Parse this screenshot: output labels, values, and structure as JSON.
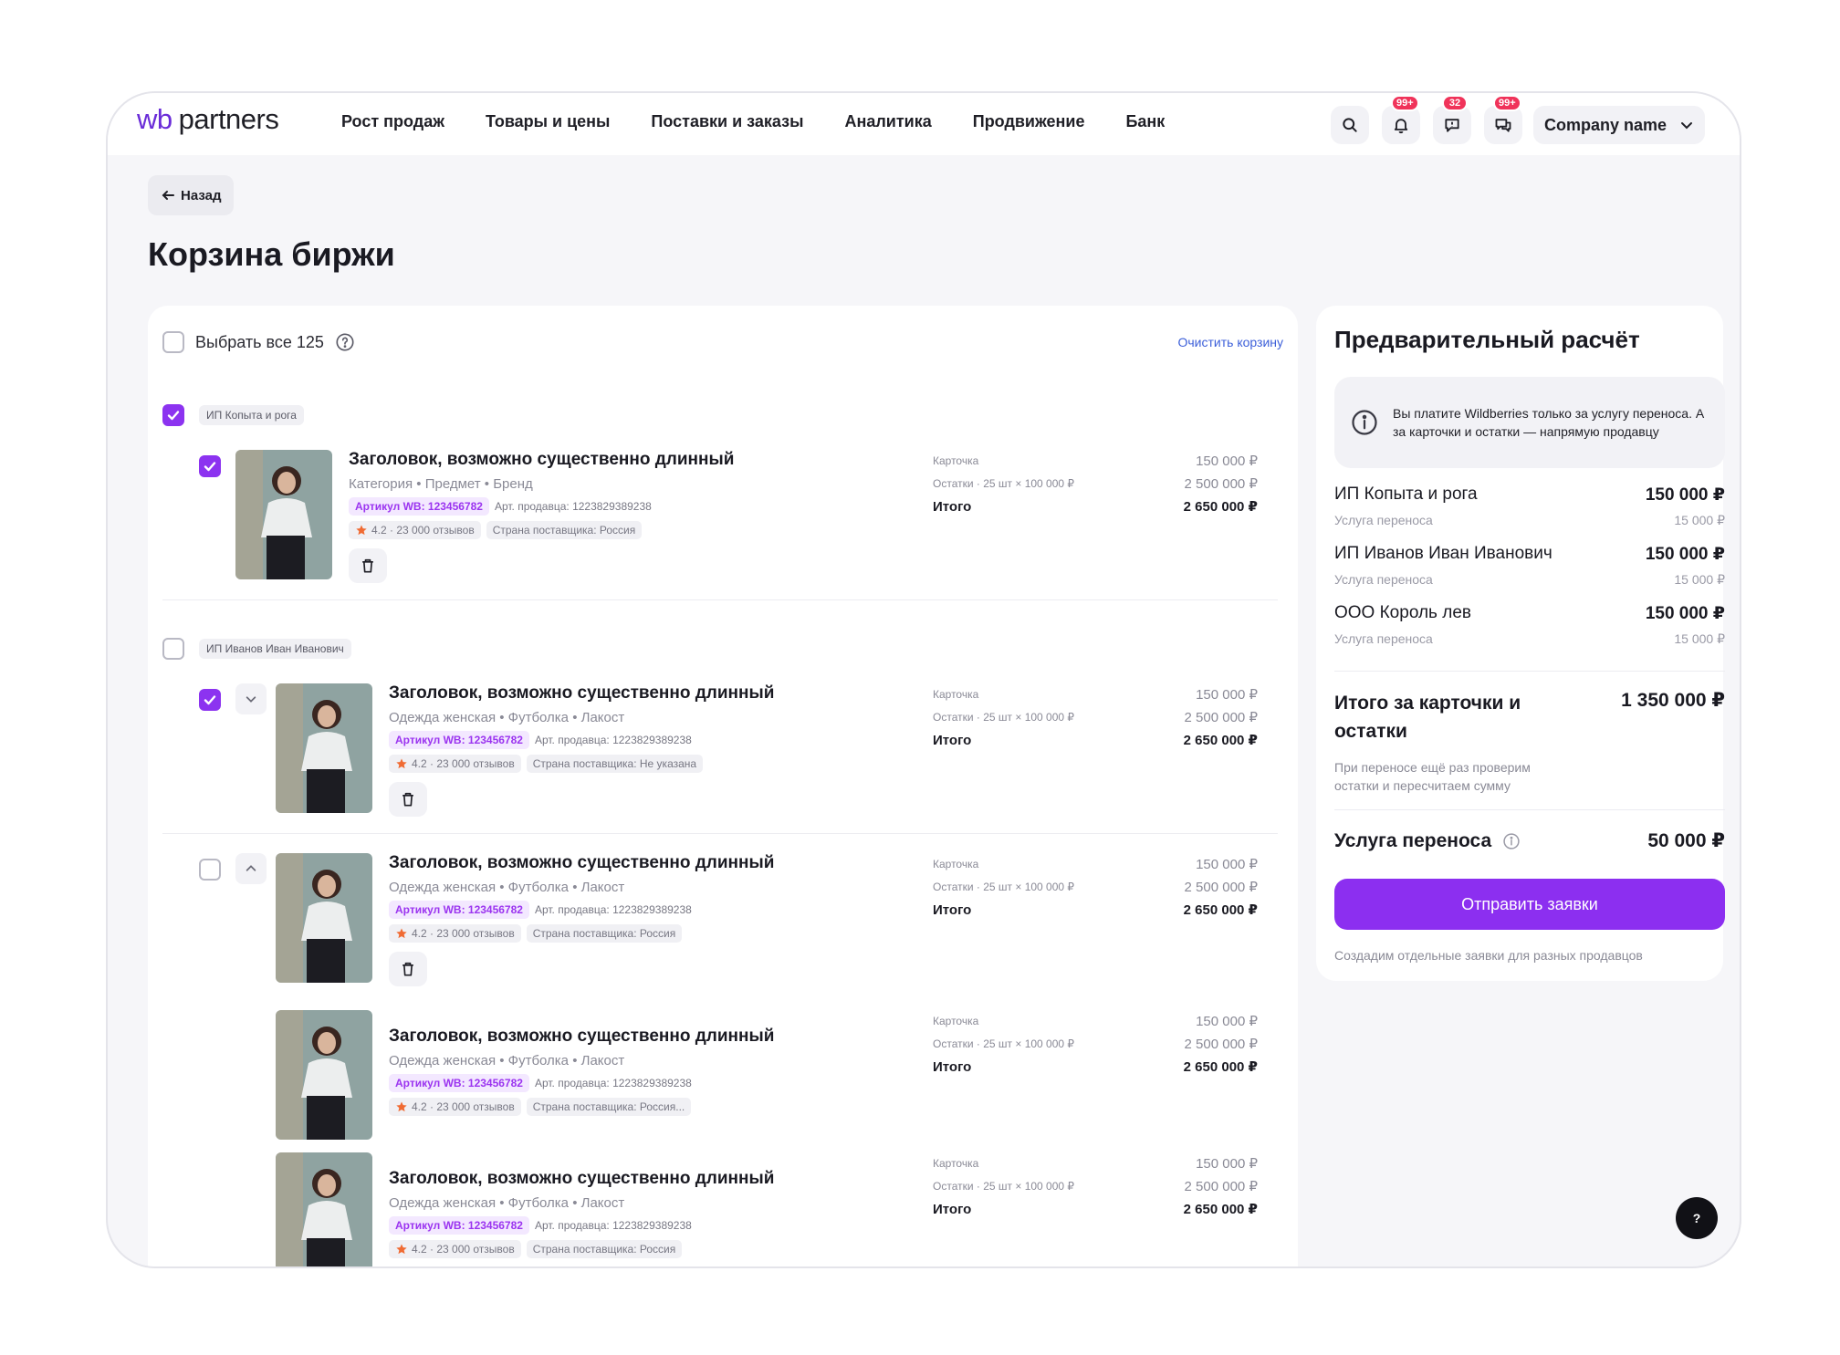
{
  "header": {
    "logo_wb": "wb",
    "logo_text": "partners",
    "nav": [
      "Рост продаж",
      "Товары и цены",
      "Поставки и заказы",
      "Аналитика",
      "Продвижение",
      "Банк"
    ],
    "badges": {
      "notifications": "99+",
      "feedback": "32",
      "chat": "99+"
    },
    "company": "Company name"
  },
  "page": {
    "back_label": "Назад",
    "title": "Корзина биржи"
  },
  "cart": {
    "select_all_label": "Выбрать все 125",
    "clear_label": "Очистить корзину",
    "row_labels": {
      "card": "Карточка",
      "stock": "Остатки · 25 шт × 100 000 ₽",
      "total": "Итого"
    },
    "row_values": {
      "card": "150 000 ₽",
      "stock": "2 500 000 ₽",
      "total": "2 650 000 ₽"
    },
    "sellers": [
      {
        "name": "ИП Копыта и рога"
      },
      {
        "name": "ИП Иванов Иван Иванович"
      }
    ],
    "items": [
      {
        "title": "Заголовок, возможно существенно длинный",
        "subtitle": "Категория • Предмет • Бренд",
        "article": "Артикул WB: 123456782",
        "seller_art": "Арт. продавца: 1223829389238",
        "rating": "4.2 · 23 000 отзывов",
        "country": "Страна поставщика: Россия"
      },
      {
        "title": "Заголовок, возможно существенно длинный",
        "subtitle": "Одежда женская • Футболка • Лакост",
        "article": "Артикул WB: 123456782",
        "seller_art": "Арт. продавца: 1223829389238",
        "rating": "4.2 · 23 000 отзывов",
        "country": "Страна поставщика: Не указана"
      },
      {
        "title": "Заголовок, возможно существенно длинный",
        "subtitle": "Одежда женская • Футболка • Лакост",
        "article": "Артикул WB: 123456782",
        "seller_art": "Арт. продавца: 1223829389238",
        "rating": "4.2 · 23 000 отзывов",
        "country": "Страна поставщика: Россия"
      },
      {
        "title": "Заголовок, возможно существенно длинный",
        "subtitle": "Одежда женская • Футболка • Лакост",
        "article": "Артикул WB: 123456782",
        "seller_art": "Арт. продавца: 1223829389238",
        "rating": "4.2 · 23 000 отзывов",
        "country": "Страна поставщика: Россия..."
      },
      {
        "title": "Заголовок, возможно существенно длинный",
        "subtitle": "Одежда женская • Футболка • Лакост",
        "article": "Артикул WB: 123456782",
        "seller_art": "Арт. продавца: 1223829389238",
        "rating": "4.2 · 23 000 отзывов",
        "country": "Страна поставщика: Россия"
      }
    ]
  },
  "summary": {
    "title": "Предварительный расчёт",
    "note": "Вы платите Wildberries только за услугу переноса. А за карточки и остатки — напрямую продавцу",
    "sellers": [
      {
        "name": "ИП Копыта и рога",
        "amount": "150 000 ₽",
        "service_label": "Услуга переноса",
        "service_amount": "15 000 ₽"
      },
      {
        "name": "ИП Иванов Иван Иванович",
        "amount": "150 000 ₽",
        "service_label": "Услуга переноса",
        "service_amount": "15 000 ₽"
      },
      {
        "name": "ООО Король лев",
        "amount": "150 000 ₽",
        "service_label": "Услуга переноса",
        "service_amount": "15 000 ₽"
      }
    ],
    "total_label": "Итого за карточки и остатки",
    "total_value": "1 350 000 ₽",
    "total_hint": "При переносе ещё раз проверим остатки и пересчитаем сумму",
    "fee_label": "Услуга переноса",
    "fee_value": "50 000 ₽",
    "submit_label": "Отправить заявки",
    "submit_note": "Создадим отдельные заявки для разных продавцов"
  },
  "help_label": "?",
  "colors": {
    "accent": "#8c2ff0",
    "badge": "#f0335a",
    "link": "#3c5fd9"
  }
}
